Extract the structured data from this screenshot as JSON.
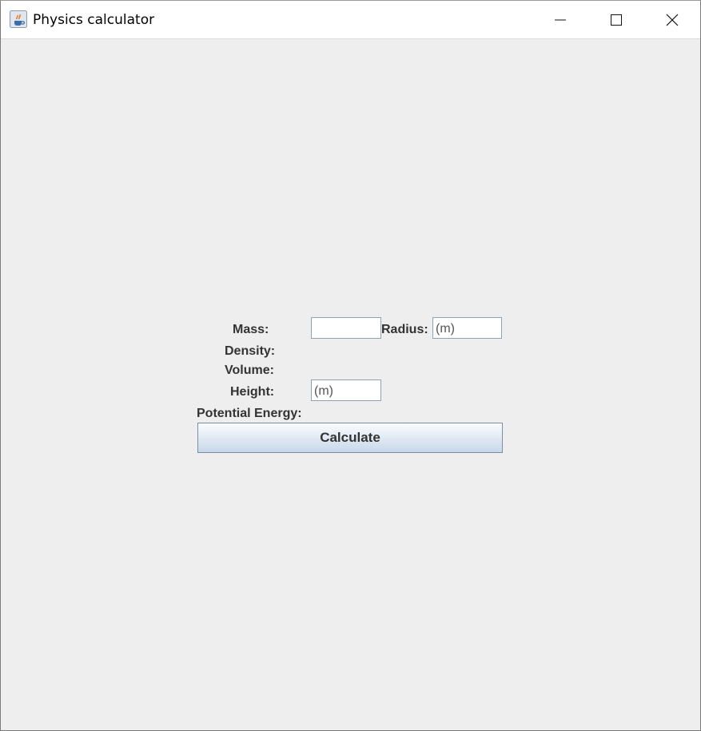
{
  "window": {
    "title": "Physics calculator",
    "minimize_icon": "minimize-icon",
    "maximize_icon": "maximize-icon",
    "close_icon": "close-icon",
    "app_icon": "java-cup-icon"
  },
  "form": {
    "mass_label": "Mass:",
    "mass_value": "",
    "radius_label": "Radius:",
    "radius_placeholder": "(m)",
    "density_label": "Density:",
    "volume_label": "Volume:",
    "height_label": "Height:",
    "height_placeholder": "(m)",
    "potential_energy_label": "Potential Energy:",
    "calculate_label": "Calculate"
  },
  "colors": {
    "background": "#eeeeee",
    "label": "#333333",
    "button_border": "#7a8ea4"
  }
}
